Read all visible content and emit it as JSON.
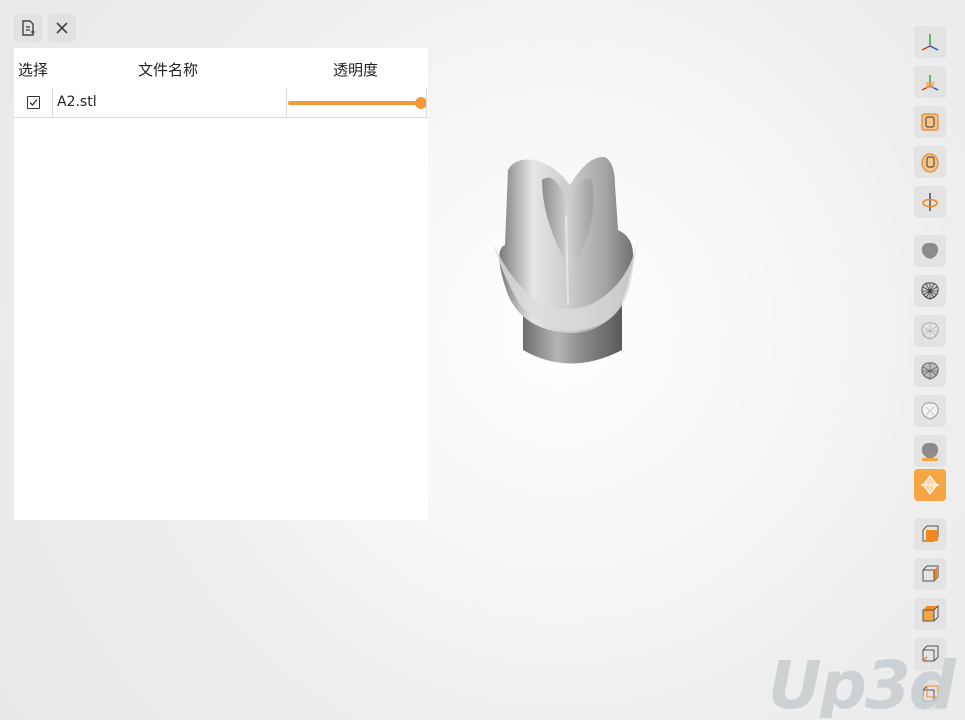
{
  "toolbar": {
    "import_icon": "file-import-icon",
    "close_icon": "close-icon"
  },
  "file_table": {
    "headers": {
      "select": "选择",
      "name": "文件名称",
      "transparency": "透明度"
    },
    "rows": [
      {
        "checked": true,
        "name": "A2.stl",
        "transparency": 1.0
      }
    ]
  },
  "view_toolbar": {
    "buttons": [
      "axis-view-icon",
      "axis-reset-icon",
      "front-view-icon",
      "side-view-icon",
      "rotate-axis-icon",
      "solid-render-icon",
      "wireframe-render-icon",
      "point-cloud-render-icon",
      "mesh-render-icon",
      "transparent-render-icon",
      "shaded-render-icon",
      "highlight-render-icon",
      "cube-front-icon",
      "cube-right-icon",
      "cube-top-icon",
      "cube-left-icon",
      "cube-back-icon"
    ],
    "active": "highlight-render-icon",
    "accent": "#f5a544"
  },
  "watermark": "Up3d"
}
